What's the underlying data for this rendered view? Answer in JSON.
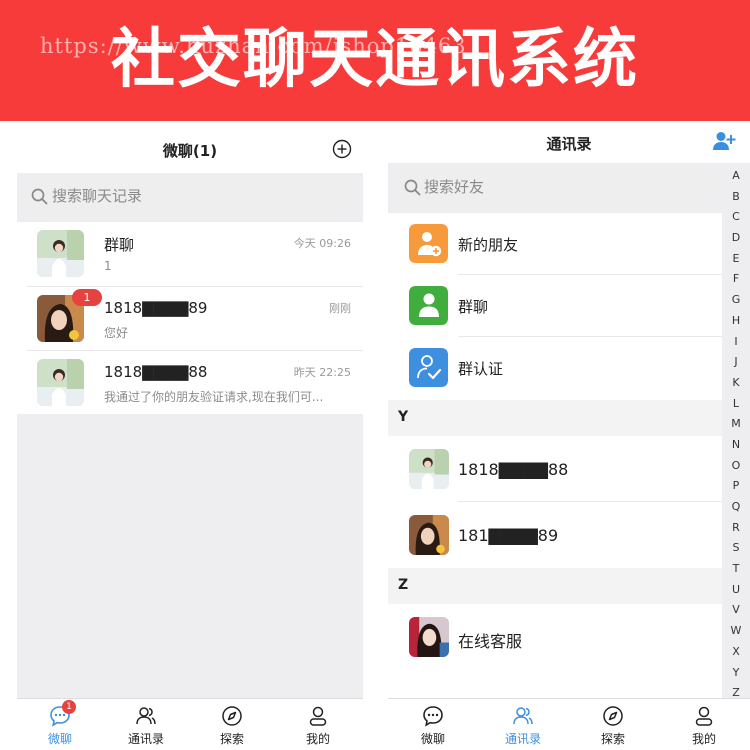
{
  "banner": {
    "title": "社交聊天通讯系统",
    "watermark": "https://www.huzhan.com/ishop16463"
  },
  "left": {
    "title": "微聊(1)",
    "search_placeholder": "搜索聊天记录",
    "chats": [
      {
        "name": "群聊",
        "message": "1",
        "time": "今天 09:26",
        "badge": ""
      },
      {
        "name": "1818▇▇▇▇89",
        "message": "您好",
        "time": "刚刚",
        "badge": "1"
      },
      {
        "name": "1818▇▇▇▇88",
        "message": "我通过了你的朋友验证请求,现在我们可...",
        "time": "昨天 22:25",
        "badge": ""
      }
    ],
    "tabs": [
      {
        "label": "微聊",
        "badge": "1",
        "active": true
      },
      {
        "label": "通讯录",
        "active": false
      },
      {
        "label": "探索",
        "active": false
      },
      {
        "label": "我的",
        "active": false
      }
    ]
  },
  "right": {
    "title": "通讯录",
    "search_placeholder": "搜索好友",
    "functions": [
      {
        "label": "新的朋友",
        "color": "#f79a3b",
        "icon": "new-friend-icon"
      },
      {
        "label": "群聊",
        "color": "#3fae3f",
        "icon": "group-chat-icon"
      },
      {
        "label": "群认证",
        "color": "#3e8fe0",
        "icon": "group-verify-icon"
      }
    ],
    "sections": [
      {
        "letter": "Y",
        "contacts": [
          {
            "name": "1818▇▇▇▇88"
          },
          {
            "name": "181▇▇▇▇89"
          }
        ]
      },
      {
        "letter": "Z",
        "contacts": [
          {
            "name": "在线客服"
          }
        ]
      }
    ],
    "index": [
      "A",
      "B",
      "C",
      "D",
      "E",
      "F",
      "G",
      "H",
      "I",
      "J",
      "K",
      "L",
      "M",
      "N",
      "O",
      "P",
      "Q",
      "R",
      "S",
      "T",
      "U",
      "V",
      "W",
      "X",
      "Y",
      "Z"
    ],
    "tabs": [
      {
        "label": "微聊",
        "active": false
      },
      {
        "label": "通讯录",
        "active": true
      },
      {
        "label": "探索",
        "active": false
      },
      {
        "label": "我的",
        "active": false
      }
    ]
  },
  "colors": {
    "banner": "#f73b3a",
    "accent": "#3b8fe0",
    "badge": "#e64340"
  }
}
